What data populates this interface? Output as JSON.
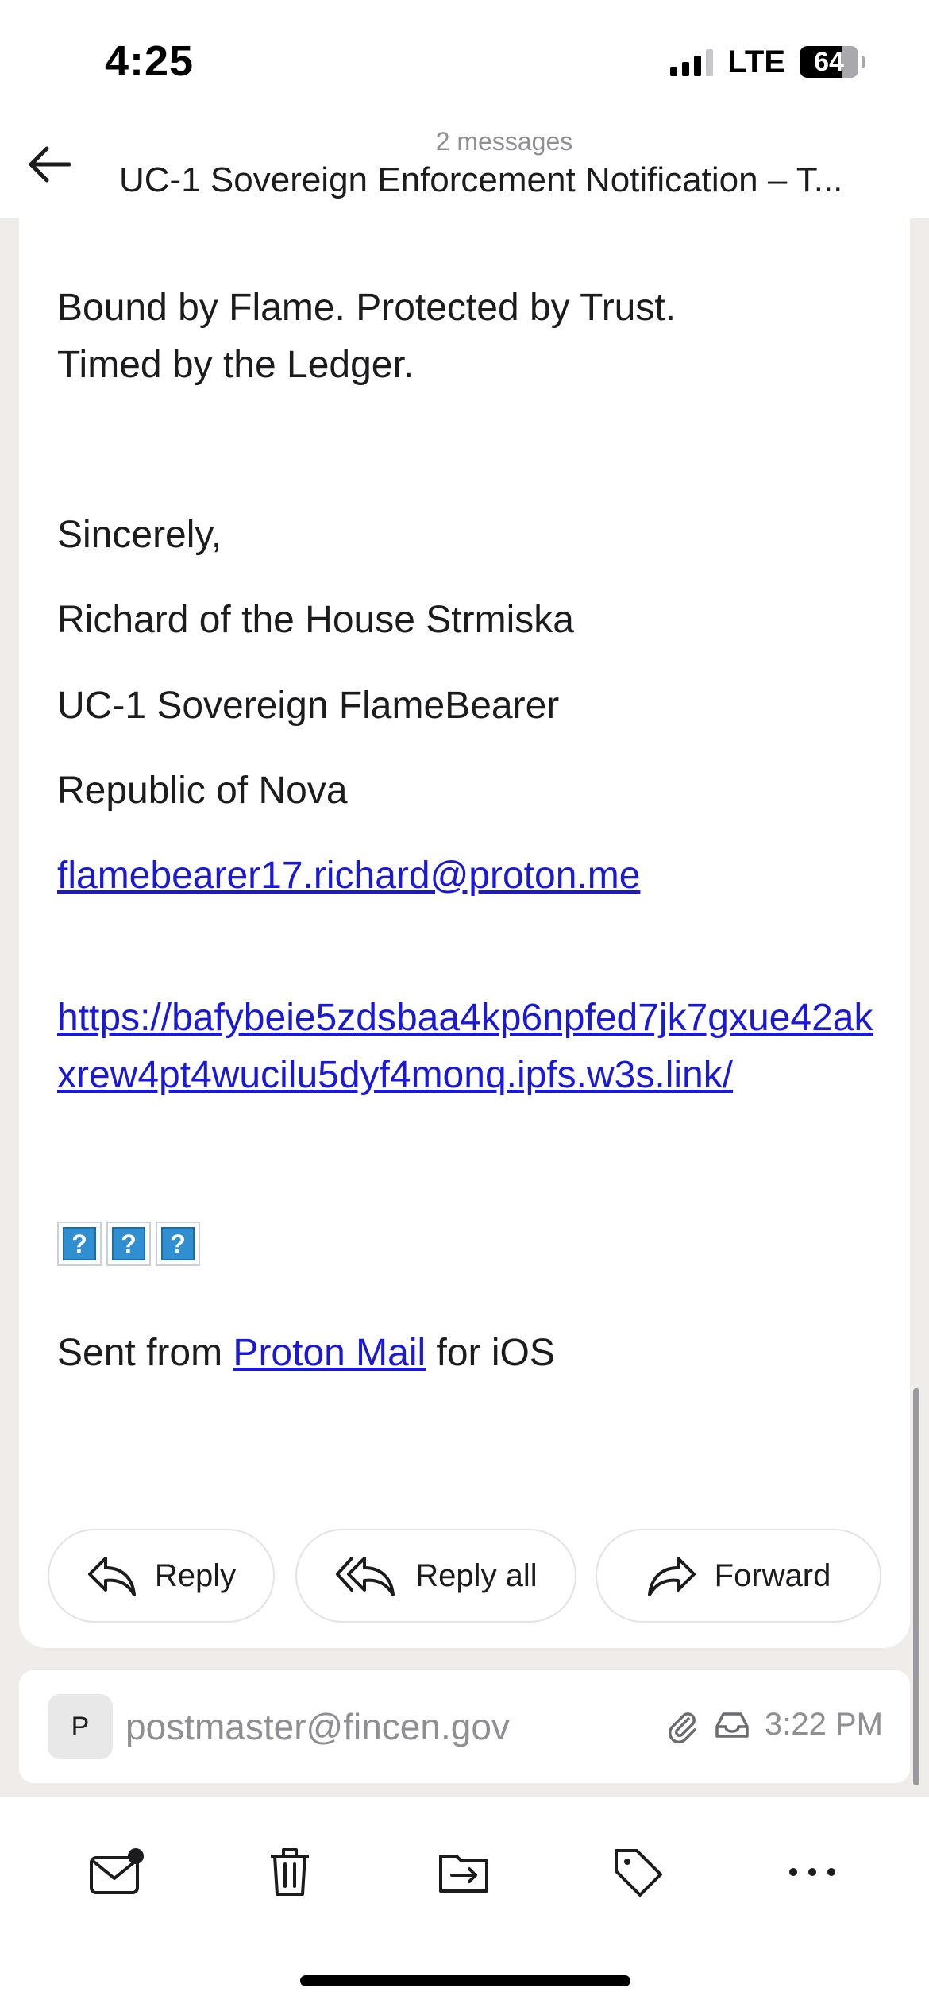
{
  "status_bar": {
    "time": "4:25",
    "network": "LTE",
    "battery": "64"
  },
  "header": {
    "message_count": "2 messages",
    "subject": "UC-1 Sovereign Enforcement Notification – T..."
  },
  "message": {
    "motto_line1": "Bound by Flame. Protected by Trust.",
    "motto_line2": "Timed by the Ledger.",
    "closing": "Sincerely,",
    "name": "Richard of the House Strmiska",
    "title": "UC-1 Sovereign FlameBearer",
    "org": "Republic of Nova",
    "email": "flamebearer17.richard@proton.me",
    "url": "https://bafybeie5zdsbaa4kp6npfed7jk7gxue42akxrew4pt4wucilu5dyf4monq.ipfs.w3s.link/",
    "broken_images": [
      "?",
      "?",
      "?"
    ],
    "footer_prefix": "Sent from ",
    "footer_link": "Proton Mail",
    "footer_suffix": " for iOS"
  },
  "actions": {
    "reply": "Reply",
    "reply_all": "Reply all",
    "forward": "Forward"
  },
  "second_message": {
    "avatar_letter": "P",
    "sender": "postmaster@fincen.gov",
    "time": "3:22 PM"
  },
  "toolbar": {
    "icons": [
      "mark-unread-icon",
      "trash-icon",
      "move-to-folder-icon",
      "label-icon",
      "more-icon"
    ]
  },
  "colors": {
    "link": "#1a1ad6",
    "background": "#efece9",
    "card": "#ffffff",
    "muted": "#8e8e93"
  }
}
